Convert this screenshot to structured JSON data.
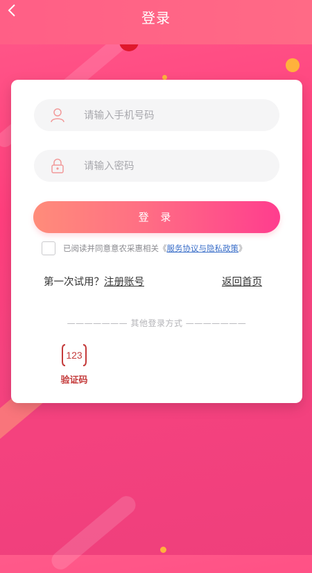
{
  "header": {
    "title": "登录"
  },
  "form": {
    "phone_placeholder": "请输入手机号码",
    "password_placeholder": "请输入密码",
    "login_button": "登 录",
    "agreement_prefix": "已阅读并同意意农采惠相关《",
    "agreement_link": "服务协议与隐私政策",
    "agreement_suffix": "》",
    "first_try_text": "第一次试用？",
    "register_link": "注册账号",
    "return_home": "返回首页",
    "other_methods": "———————  其他登录方式  ———————",
    "sms_icon_text": "123",
    "sms_label": "验证码"
  },
  "colors": {
    "accent": "#ff3f7d",
    "button_start": "#ff8c7a",
    "button_end": "#ff3d8e",
    "link": "#3b6fc9",
    "sms_label": "#c43a3a"
  },
  "icons": {
    "back": "chevron-left-icon",
    "phone": "user-icon",
    "password": "lock-icon",
    "sms": "verification-code-icon"
  }
}
